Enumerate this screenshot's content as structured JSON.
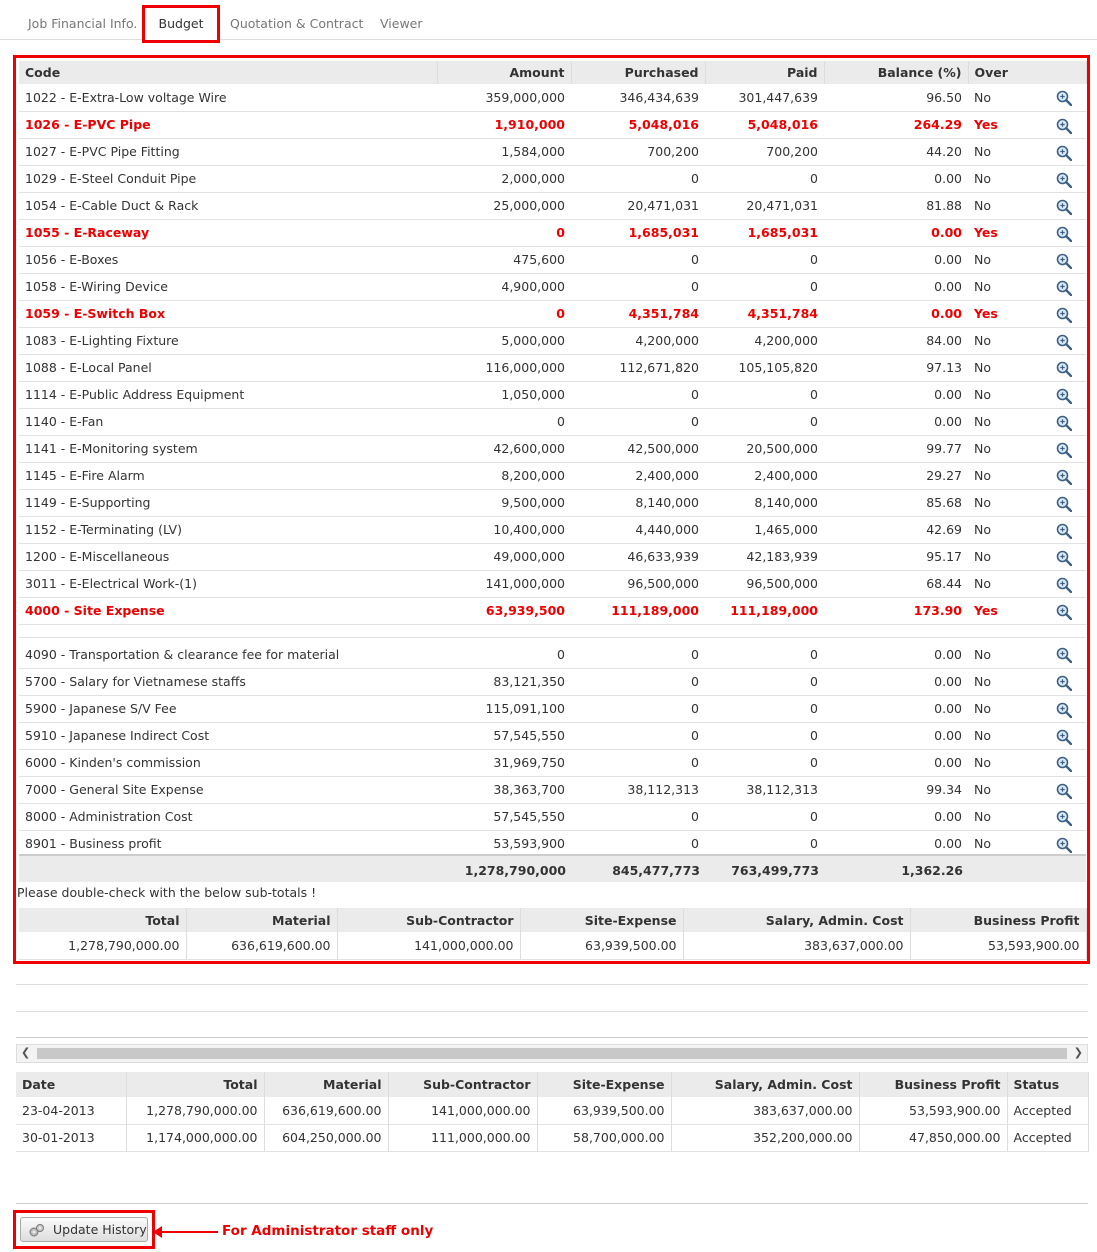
{
  "tabs": [
    {
      "label": "Job Financial Info."
    },
    {
      "label": "Budget"
    },
    {
      "label": "Quotation & Contract"
    },
    {
      "label": "Viewer"
    }
  ],
  "budget": {
    "headers": [
      "Code",
      "Amount",
      "Purchased",
      "Paid",
      "Balance (%)",
      "Over"
    ],
    "rows": [
      {
        "code": "1022 - E-Extra-Low voltage Wire",
        "amount": "359,000,000",
        "purchased": "346,434,639",
        "paid": "301,447,639",
        "balance": "96.50",
        "over": "No"
      },
      {
        "code": "1026 - E-PVC Pipe",
        "amount": "1,910,000",
        "purchased": "5,048,016",
        "paid": "5,048,016",
        "balance": "264.29",
        "over": "Yes"
      },
      {
        "code": "1027 - E-PVC Pipe Fitting",
        "amount": "1,584,000",
        "purchased": "700,200",
        "paid": "700,200",
        "balance": "44.20",
        "over": "No"
      },
      {
        "code": "1029 - E-Steel Conduit Pipe",
        "amount": "2,000,000",
        "purchased": "0",
        "paid": "0",
        "balance": "0.00",
        "over": "No"
      },
      {
        "code": "1054 - E-Cable Duct & Rack",
        "amount": "25,000,000",
        "purchased": "20,471,031",
        "paid": "20,471,031",
        "balance": "81.88",
        "over": "No"
      },
      {
        "code": "1055 - E-Raceway",
        "amount": "0",
        "purchased": "1,685,031",
        "paid": "1,685,031",
        "balance": "0.00",
        "over": "Yes"
      },
      {
        "code": "1056 - E-Boxes",
        "amount": "475,600",
        "purchased": "0",
        "paid": "0",
        "balance": "0.00",
        "over": "No"
      },
      {
        "code": "1058 - E-Wiring Device",
        "amount": "4,900,000",
        "purchased": "0",
        "paid": "0",
        "balance": "0.00",
        "over": "No"
      },
      {
        "code": "1059 - E-Switch Box",
        "amount": "0",
        "purchased": "4,351,784",
        "paid": "4,351,784",
        "balance": "0.00",
        "over": "Yes"
      },
      {
        "code": "1083 - E-Lighting Fixture",
        "amount": "5,000,000",
        "purchased": "4,200,000",
        "paid": "4,200,000",
        "balance": "84.00",
        "over": "No"
      },
      {
        "code": "1088 - E-Local Panel",
        "amount": "116,000,000",
        "purchased": "112,671,820",
        "paid": "105,105,820",
        "balance": "97.13",
        "over": "No"
      },
      {
        "code": "1114 - E-Public Address Equipment",
        "amount": "1,050,000",
        "purchased": "0",
        "paid": "0",
        "balance": "0.00",
        "over": "No"
      },
      {
        "code": "1140 - E-Fan",
        "amount": "0",
        "purchased": "0",
        "paid": "0",
        "balance": "0.00",
        "over": "No"
      },
      {
        "code": "1141 - E-Monitoring system",
        "amount": "42,600,000",
        "purchased": "42,500,000",
        "paid": "20,500,000",
        "balance": "99.77",
        "over": "No"
      },
      {
        "code": "1145 - E-Fire Alarm",
        "amount": "8,200,000",
        "purchased": "2,400,000",
        "paid": "2,400,000",
        "balance": "29.27",
        "over": "No"
      },
      {
        "code": "1149 - E-Supporting",
        "amount": "9,500,000",
        "purchased": "8,140,000",
        "paid": "8,140,000",
        "balance": "85.68",
        "over": "No"
      },
      {
        "code": "1152 - E-Terminating (LV)",
        "amount": "10,400,000",
        "purchased": "4,440,000",
        "paid": "1,465,000",
        "balance": "42.69",
        "over": "No"
      },
      {
        "code": "1200 - E-Miscellaneous",
        "amount": "49,000,000",
        "purchased": "46,633,939",
        "paid": "42,183,939",
        "balance": "95.17",
        "over": "No"
      },
      {
        "code": "3011 - E-Electrical Work-(1)",
        "amount": "141,000,000",
        "purchased": "96,500,000",
        "paid": "96,500,000",
        "balance": "68.44",
        "over": "No"
      },
      {
        "code": "4000 - Site Expense",
        "amount": "63,939,500",
        "purchased": "111,189,000",
        "paid": "111,189,000",
        "balance": "173.90",
        "over": "Yes"
      }
    ],
    "rows2": [
      {
        "code": "4090 - Transportation & clearance fee for material",
        "amount": "0",
        "purchased": "0",
        "paid": "0",
        "balance": "0.00",
        "over": "No"
      },
      {
        "code": "5700 - Salary for Vietnamese staffs",
        "amount": "83,121,350",
        "purchased": "0",
        "paid": "0",
        "balance": "0.00",
        "over": "No"
      },
      {
        "code": "5900 - Japanese S/V Fee",
        "amount": "115,091,100",
        "purchased": "0",
        "paid": "0",
        "balance": "0.00",
        "over": "No"
      },
      {
        "code": "5910 - Japanese Indirect Cost",
        "amount": "57,545,550",
        "purchased": "0",
        "paid": "0",
        "balance": "0.00",
        "over": "No"
      },
      {
        "code": "6000 - Kinden's commission",
        "amount": "31,969,750",
        "purchased": "0",
        "paid": "0",
        "balance": "0.00",
        "over": "No"
      },
      {
        "code": "7000 - General Site Expense",
        "amount": "38,363,700",
        "purchased": "38,112,313",
        "paid": "38,112,313",
        "balance": "99.34",
        "over": "No"
      },
      {
        "code": "8000 - Administration Cost",
        "amount": "57,545,550",
        "purchased": "0",
        "paid": "0",
        "balance": "0.00",
        "over": "No"
      },
      {
        "code": "8901 - Business profit",
        "amount": "53,593,900",
        "purchased": "0",
        "paid": "0",
        "balance": "0.00",
        "over": "No"
      }
    ],
    "totals": {
      "amount": "1,278,790,000",
      "purchased": "845,477,773",
      "paid": "763,499,773",
      "balance": "1,362.26"
    },
    "note": "Please double-check with the below sub-totals !",
    "subtotals": {
      "headers": [
        "Total",
        "Material",
        "Sub-Contractor",
        "Site-Expense",
        "Salary, Admin. Cost",
        "Business Profit"
      ],
      "values": [
        "1,278,790,000.00",
        "636,619,600.00",
        "141,000,000.00",
        "63,939,500.00",
        "383,637,000.00",
        "53,593,900.00"
      ]
    }
  },
  "history": {
    "headers": [
      "Date",
      "Total",
      "Material",
      "Sub-Contractor",
      "Site-Expense",
      "Salary, Admin. Cost",
      "Business Profit",
      "Status"
    ],
    "rows": [
      [
        "23-04-2013",
        "1,278,790,000.00",
        "636,619,600.00",
        "141,000,000.00",
        "63,939,500.00",
        "383,637,000.00",
        "53,593,900.00",
        "Accepted"
      ],
      [
        "30-01-2013",
        "1,174,000,000.00",
        "604,250,000.00",
        "111,000,000.00",
        "58,700,000.00",
        "352,200,000.00",
        "47,850,000.00",
        "Accepted"
      ]
    ]
  },
  "update_button": "Update History",
  "admin_note": "For Administrator staff only",
  "colors": {
    "highlight": "#e00000",
    "header_bg": "#ebebeb"
  },
  "icons": {
    "detail": "magnifier-icon",
    "update": "gears-icon"
  }
}
